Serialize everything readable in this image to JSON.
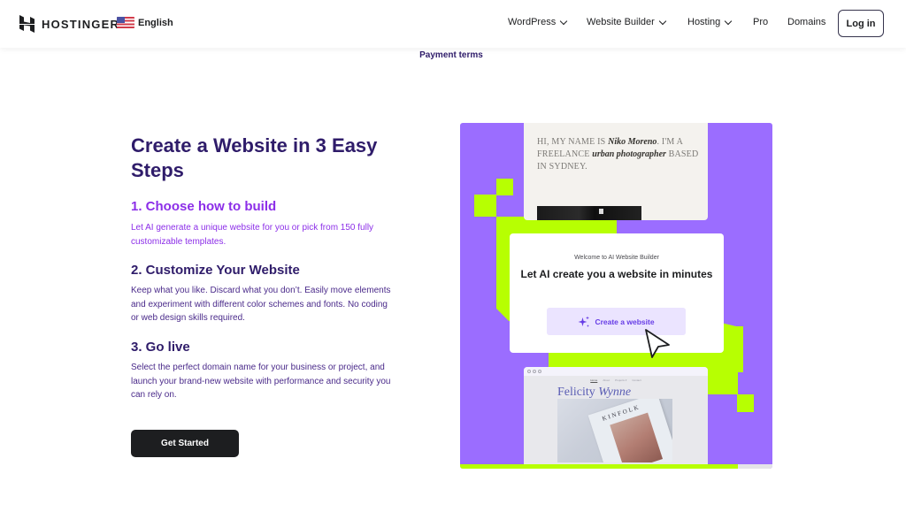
{
  "header": {
    "brand": "HOSTINGER",
    "language": "English",
    "nav": [
      {
        "label": "WordPress",
        "has_dropdown": true
      },
      {
        "label": "Website Builder",
        "has_dropdown": true
      },
      {
        "label": "Hosting",
        "has_dropdown": true
      },
      {
        "label": "Pro",
        "has_dropdown": false
      },
      {
        "label": "Domains",
        "has_dropdown": false
      }
    ],
    "login_label": "Log in"
  },
  "payment_terms_label": "Payment terms",
  "main": {
    "title": "Create a Website in 3 Easy Steps",
    "steps": [
      {
        "title": "1. Choose how to build",
        "description": "Let AI generate a unique website for you or pick from 150 fully customizable templates."
      },
      {
        "title": "2. Customize Your Website",
        "description": "Keep what you like. Discard what you don’t. Easily move elements and experiment with different color schemes and fonts. No coding or web design skills required."
      },
      {
        "title": "3. Go live",
        "description": "Select the perfect domain name for your business or project, and launch your brand-new website with performance and security you can rely on."
      }
    ],
    "cta_label": "Get Started"
  },
  "illustration": {
    "portfolio_card": {
      "text_prefix": "Hi, my name is ",
      "name": "Niko Moreno",
      "text_mid": ". I'm a freelance ",
      "role": "urban photographer",
      "text_suffix": " based in Sydney."
    },
    "builder_card": {
      "subtitle": "Welcome to AI Website Builder",
      "title": "Let AI create you a website in minutes",
      "button_label": "Create a website"
    },
    "template_card": {
      "nav": [
        "Home",
        "About",
        "Projects ▾",
        "Contact"
      ],
      "name_first": "Felicity ",
      "name_last": "Wynne",
      "magazine_title": "KINFOLK"
    },
    "progress_fraction": 0.89,
    "colors": {
      "purple": "#9b6dff",
      "lime": "#b7ff02",
      "violet_text": "#673de6"
    }
  }
}
